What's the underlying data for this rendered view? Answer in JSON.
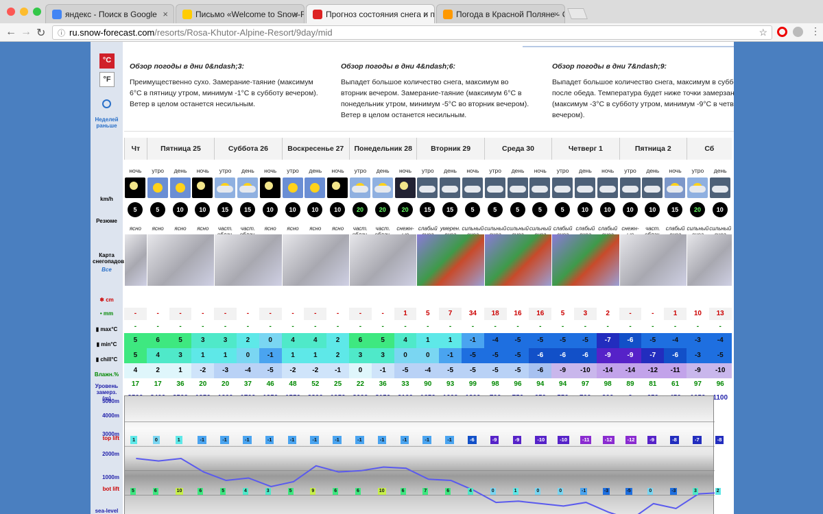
{
  "browser": {
    "tabs": [
      {
        "title": "яндекс - Поиск в Google",
        "fav": "google-icon",
        "color": "#4285f4"
      },
      {
        "title": "Письмо «Welcome to Snow-F",
        "fav": "mail-icon",
        "color": "#ffcc00"
      },
      {
        "title": "Прогноз состояния снега и п",
        "fav": "snowforecast-icon",
        "color": "#d22",
        "active": true
      },
      {
        "title": "Погода в Красной Поляне - С",
        "fav": "weather-icon",
        "color": "#f90"
      }
    ],
    "url_host": "ru.snow-forecast.com",
    "url_path": "/resorts/Rosa-Khutor-Alpine-Resort/9day/mid"
  },
  "units": {
    "celsius": "°C",
    "fahrenheit": "°F",
    "prev": "Неделей раньше"
  },
  "overview": [
    {
      "title": "Обзор погоды в дни 0&ndash;3:",
      "text": "Преимущественно сухо. Замерание-таяние (максимум 6°C в пятницу утром, минимум -1°C в субботу вечером). Ветер в целом останется несильным."
    },
    {
      "title": "Обзор погоды в дни 4&ndash;6:",
      "text": "Выпадет большое количество снега, максимум во вторник вечером. Замерание-таяние (максимум 6°C в понедельник утром, минимум -5°C во вторник вечером). Ветер в целом останется несильным."
    },
    {
      "title": "Обзор погоды в дни 7&ndash;9:",
      "text": "Выпадет большое количество снега, максимум в субботу после обеда. Температура будет ниже точки замерзания (максимум -3°C в субботу утром, минимум -9°C в четверг вечером)."
    }
  ],
  "labels": {
    "wind": "km/h",
    "summary": "Резюме",
    "map": "Карта снегопадов",
    "map_all": "Все",
    "snow": "cm",
    "rain": "mm",
    "max": "max°C",
    "min": "min°C",
    "chill": "chill°C",
    "humid": "Влажн.%",
    "freeze": "Уровень замерз. (m)",
    "toplift": "top lift",
    "botlift": "bot lift",
    "sealevel": "sea-level"
  },
  "alt_labels": [
    "5000m",
    "4000m",
    "3000m",
    "2000m",
    "1000m"
  ],
  "days": [
    {
      "name": "Чт",
      "span": 1
    },
    {
      "name": "Пятница 25",
      "span": 3
    },
    {
      "name": "Суббота 26",
      "span": 3
    },
    {
      "name": "Воскресенье 27",
      "span": 3
    },
    {
      "name": "Понедельник 28",
      "span": 3
    },
    {
      "name": "Вторник 29",
      "span": 3
    },
    {
      "name": "Среда 30",
      "span": 3
    },
    {
      "name": "Четверг 1",
      "span": 3
    },
    {
      "name": "Пятница 2",
      "span": 3
    },
    {
      "name": "Сб",
      "span": 2
    }
  ],
  "periods": [
    "ночь",
    "утро",
    "день",
    "ночь",
    "утро",
    "день",
    "ночь",
    "утро",
    "день",
    "ночь",
    "утро",
    "день",
    "ночь",
    "утро",
    "день",
    "ночь",
    "утро",
    "день",
    "ночь",
    "утро",
    "день",
    "ночь",
    "утро",
    "день",
    "ночь",
    "утро",
    "день"
  ],
  "wx": [
    "moon",
    "sun",
    "sun",
    "moon",
    "cloudsun",
    "cloudsun",
    "moon",
    "sun",
    "sun",
    "moon",
    "cloudsun",
    "cloudsun",
    "snowmoon",
    "snow",
    "snow",
    "snow",
    "snow",
    "snow",
    "snow",
    "snow",
    "snow",
    "snow",
    "snow",
    "snow",
    "snowsun",
    "cloudsun",
    "snow"
  ],
  "wind": [
    5,
    5,
    10,
    10,
    15,
    15,
    10,
    10,
    10,
    10,
    20,
    20,
    20,
    15,
    15,
    5,
    5,
    5,
    5,
    5,
    10,
    10,
    10,
    10,
    15,
    20,
    10
  ],
  "summary": [
    "ясно",
    "ясно",
    "ясно",
    "ясно",
    "част. облач.",
    "част. облач.",
    "ясно",
    "ясно",
    "ясно",
    "ясно",
    "част. облач.",
    "част. облач.",
    "снежн- ые ливни",
    "слабый снег",
    "умерен. снег",
    "сильный снег",
    "сильный снег",
    "сильный снег",
    "сильный снег",
    "слабый снег",
    "слабый снег",
    "слабый снег",
    "снежн- ые ливни",
    "част. облач.",
    "слабый снег",
    "сильный снег",
    "сильный снег"
  ],
  "snow": [
    "-",
    "-",
    "-",
    "-",
    "-",
    "-",
    "-",
    "-",
    "-",
    "-",
    "-",
    "-",
    "1",
    "5",
    "7",
    "34",
    "18",
    "16",
    "16",
    "5",
    "3",
    "2",
    "-",
    "-",
    "1",
    "10",
    "13"
  ],
  "rain": [
    "-",
    "-",
    "-",
    "-",
    "-",
    "-",
    "-",
    "-",
    "-",
    "-",
    "-",
    "-",
    "-",
    "-",
    "-",
    "-",
    "-",
    "-",
    "-",
    "-",
    "-",
    "-",
    "-",
    "-",
    "-",
    "-",
    "-"
  ],
  "max": [
    5,
    6,
    5,
    3,
    3,
    2,
    0,
    4,
    4,
    2,
    6,
    5,
    4,
    1,
    1,
    -1,
    -4,
    -5,
    -5,
    -5,
    -5,
    -7,
    -6,
    -5,
    -4,
    -3,
    -4
  ],
  "min": [
    5,
    4,
    3,
    1,
    1,
    0,
    -1,
    1,
    1,
    2,
    3,
    3,
    0,
    0,
    -1,
    -5,
    -5,
    -5,
    -6,
    -6,
    -6,
    -9,
    -9,
    -7,
    -6,
    -3,
    -5
  ],
  "chill": [
    4,
    2,
    1,
    -2,
    -3,
    -4,
    -5,
    -2,
    -2,
    -1,
    0,
    -1,
    -5,
    -4,
    -5,
    -5,
    -5,
    -5,
    -6,
    -9,
    -10,
    -14,
    -14,
    -12,
    -11,
    -9,
    -10
  ],
  "humid": [
    17,
    17,
    36,
    20,
    20,
    37,
    46,
    48,
    52,
    25,
    22,
    36,
    33,
    90,
    93,
    99,
    98,
    96,
    94,
    94,
    97,
    98,
    89,
    81,
    61,
    97,
    96
  ],
  "freeze": [
    2500,
    2400,
    2500,
    1950,
    1600,
    1700,
    1350,
    1550,
    2200,
    1950,
    2000,
    2150,
    2100,
    1650,
    1600,
    1200,
    700,
    750,
    650,
    550,
    700,
    300,
    0,
    650,
    450,
    1050,
    1100
  ],
  "top_temps": [
    1,
    0,
    1,
    -1,
    -1,
    -1,
    -1,
    -1,
    -1,
    -1,
    -1,
    -1,
    -1,
    -1,
    -1,
    -6,
    -9,
    -9,
    -10,
    -10,
    -11,
    -12,
    -12,
    -9,
    -8,
    -7,
    -8
  ],
  "bot_temps": [
    5,
    6,
    10,
    6,
    5,
    4,
    3,
    5,
    9,
    6,
    6,
    10,
    6,
    7,
    6,
    4,
    0,
    1,
    0,
    0,
    -1,
    -3,
    -5,
    0,
    -3,
    3,
    2
  ]
}
